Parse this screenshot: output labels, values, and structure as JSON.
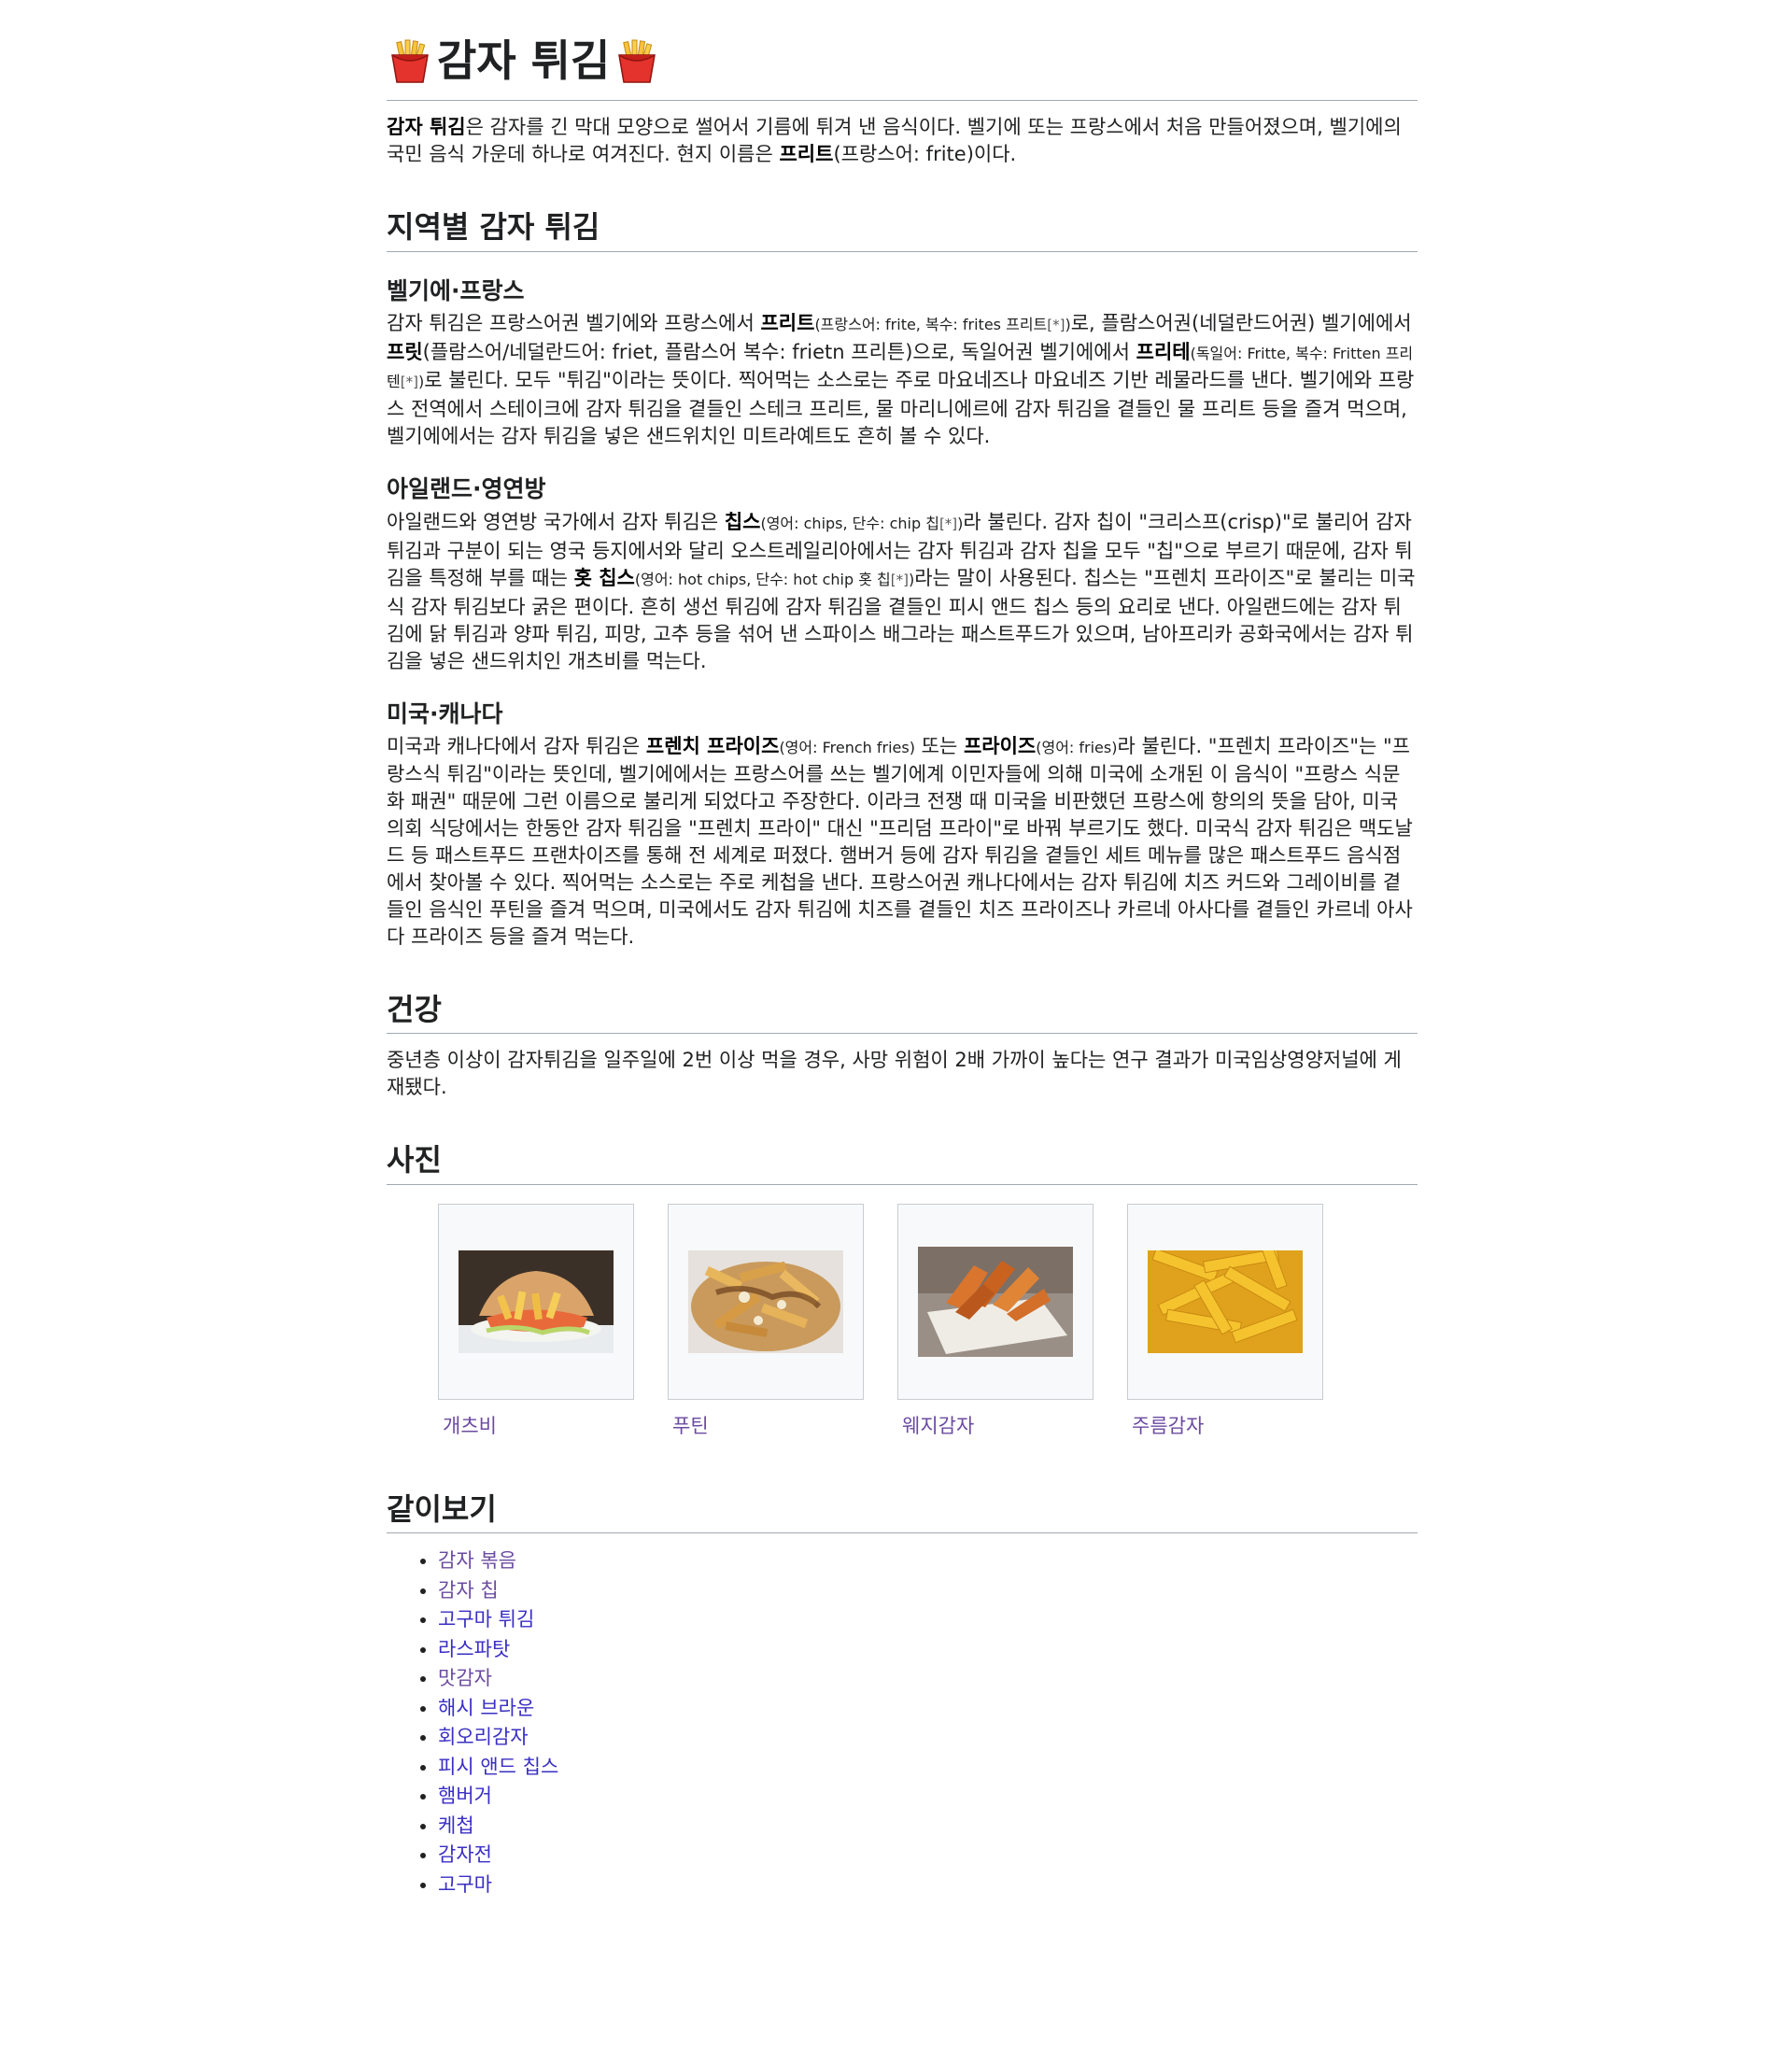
{
  "title": "감자 튀김",
  "intro": {
    "bold1": "감자 튀김",
    "text1": "은 감자를 긴 막대 모양으로 썰어서 기름에 튀겨 낸 음식이다. 벨기에 또는 프랑스에서 처음 만들어졌으며, 벨기에의 국민 음식 가운데 하나로 여겨진다. 현지 이름은 ",
    "bold2": "프리트",
    "text2": "(프랑스어: frite)이다."
  },
  "sections": {
    "regional": {
      "heading": "지역별 감자 튀김",
      "belgium": {
        "heading": "벨기에·프랑스",
        "t1": "감자 튀김은 프랑스어권 벨기에와 프랑스에서 ",
        "b1": "프리트",
        "s1": "(프랑스어: frite, 복수: frites 프리트",
        "r1": "[*]",
        "s1b": ")",
        "t2": "로, 플람스어권(네덜란드어권) 벨기에에서 ",
        "b2": "프릿",
        "t3": "(플람스어/네덜란드어: friet, 플람스어 복수: frietn 프리튼)으로, 독일어권 벨기에에서 ",
        "b3": "프리테",
        "s3": "(독일어: Fritte, 복수: Fritten 프리텐",
        "r3": "[*]",
        "s3b": ")",
        "t4": "로 불린다. 모두 \"튀김\"이라는 뜻이다. 찍어먹는 소스로는 주로 마요네즈나 마요네즈 기반 레물라드를 낸다. 벨기에와 프랑스 전역에서 스테이크에 감자 튀김을 곁들인 스테크 프리트, 물 마리니에르에 감자 튀김을 곁들인 물 프리트 등을 즐겨 먹으며, 벨기에에서는 감자 튀김을 넣은 샌드위치인 미트라예트도 흔히 볼 수 있다."
      },
      "ireland": {
        "heading": "아일랜드·영연방",
        "t1": "아일랜드와 영연방 국가에서 감자 튀김은 ",
        "b1": "칩스",
        "s1": "(영어: chips, 단수: chip 칩",
        "r1": "[*]",
        "s1b": ")",
        "t2": "라 불린다. 감자 칩이 \"크리스프(crisp)\"로 불리어 감자 튀김과 구분이 되는 영국 등지에서와 달리 오스트레일리아에서는 감자 튀김과 감자 칩을 모두 \"칩\"으로 부르기 때문에, 감자 튀김을 특정해 부를 때는 ",
        "b2": "홋 칩스",
        "s2": "(영어: hot chips, 단수: hot chip 홋 칩",
        "r2": "[*]",
        "s2b": ")",
        "t3": "라는 말이 사용된다. 칩스는 \"프렌치 프라이즈\"로 불리는 미국식 감자 튀김보다 굵은 편이다. 흔히 생선 튀김에 감자 튀김을 곁들인 피시 앤드 칩스 등의 요리로 낸다. 아일랜드에는 감자 튀김에 닭 튀김과 양파 튀김, 피망, 고추 등을 섞어 낸 스파이스 배그라는 패스트푸드가 있으며, 남아프리카 공화국에서는 감자 튀김을 넣은 샌드위치인 개츠비를 먹는다."
      },
      "usa": {
        "heading": "미국·캐나다",
        "t1": "미국과 캐나다에서 감자 튀김은 ",
        "b1": "프렌치 프라이즈",
        "s1": "(영어: French fries)",
        "t2": " 또는 ",
        "b2": "프라이즈",
        "s2": "(영어: fries)",
        "t3": "라 불린다. \"프렌치 프라이즈\"는 \"프랑스식 튀김\"이라는 뜻인데, 벨기에에서는 프랑스어를 쓰는 벨기에계 이민자들에 의해 미국에 소개된 이 음식이 \"프랑스 식문화 패권\" 때문에 그런 이름으로 불리게 되었다고 주장한다. 이라크 전쟁 때 미국을 비판했던 프랑스에 항의의 뜻을 담아, 미국 의회 식당에서는 한동안 감자 튀김을 \"프렌치 프라이\" 대신 \"프리덤 프라이\"로 바꿔 부르기도 했다. 미국식 감자 튀김은 맥도날드 등 패스트푸드 프랜차이즈를 통해 전 세계로 퍼졌다. 햄버거 등에 감자 튀김을 곁들인 세트 메뉴를 많은 패스트푸드 음식점에서 찾아볼 수 있다. 찍어먹는 소스로는 주로 케첩을 낸다. 프랑스어권 캐나다에서는 감자 튀김에 치즈 커드와 그레이비를 곁들인 음식인 푸틴을 즐겨 먹으며, 미국에서도 감자 튀김에 치즈를 곁들인 치즈 프라이즈나 카르네 아사다를 곁들인 카르네 아사다 프라이즈 등을 즐겨 먹는다."
      }
    },
    "health": {
      "heading": "건강",
      "text": "중년층 이상이 감자튀김을 일주일에 2번 이상 먹을 경우, 사망 위험이 2배 가까이 높다는 연구 결과가 미국임상영양저널에 게재됐다."
    },
    "photos": {
      "heading": "사진",
      "items": [
        {
          "caption": "개츠비"
        },
        {
          "caption": "푸틴"
        },
        {
          "caption": "웨지감자"
        },
        {
          "caption": "주름감자"
        }
      ]
    },
    "see_also": {
      "heading": "같이보기",
      "items": [
        "감자 볶음",
        "감자 칩",
        "고구마 튀김",
        "라스파탓",
        "맛감자",
        "해시 브라운",
        "회오리감자",
        "피시 앤드 칩스",
        "햄버거",
        "케첩",
        "감자전",
        "고구마"
      ]
    }
  },
  "colors": {
    "link": "#3a2fc4",
    "visited_link": "#6b4ba1",
    "text": "#202122",
    "rule": "#a2a9b1"
  }
}
